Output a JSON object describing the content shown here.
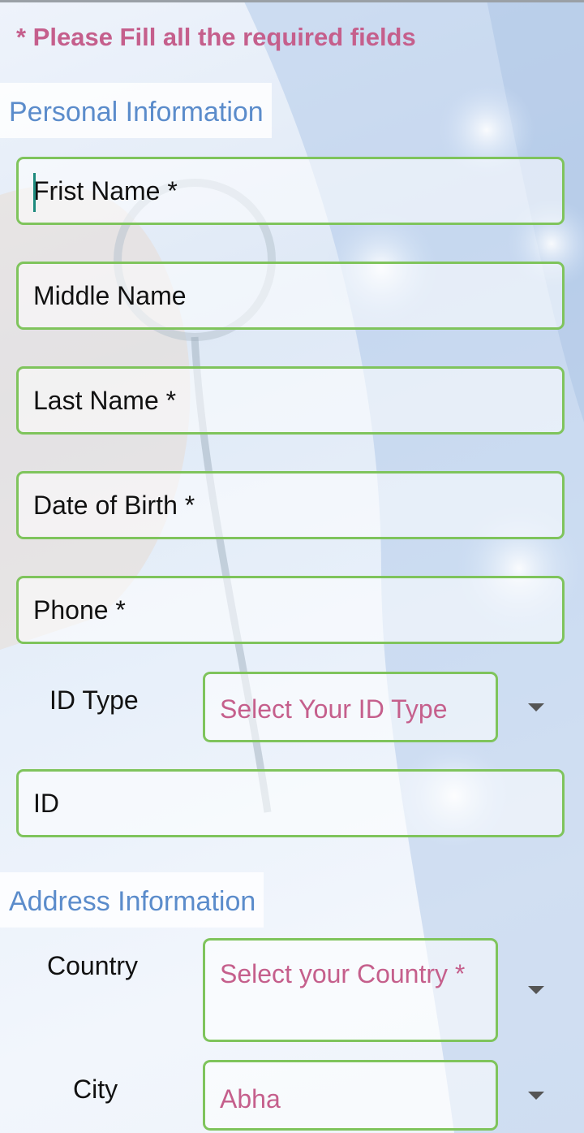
{
  "notice": "* Please Fill all the required fields",
  "personal": {
    "title": "Personal Information",
    "first_name": "Frist Name *",
    "middle_name": "Middle Name",
    "last_name": "Last Name *",
    "dob": "Date of Birth *",
    "phone": "Phone *",
    "id_type_label": "ID Type",
    "id_type_value": "Select Your ID Type",
    "id": "ID"
  },
  "address": {
    "title": "Address Information",
    "country_label": "Country",
    "country_value": "Select your Country *",
    "city_label": "City",
    "city_value": "Abha"
  },
  "colors": {
    "accent_pink": "#c55f8c",
    "section_blue": "#5b8ccb",
    "field_border_green": "#7fc45c"
  },
  "icons": {
    "dropdown": "caret-down-icon"
  }
}
